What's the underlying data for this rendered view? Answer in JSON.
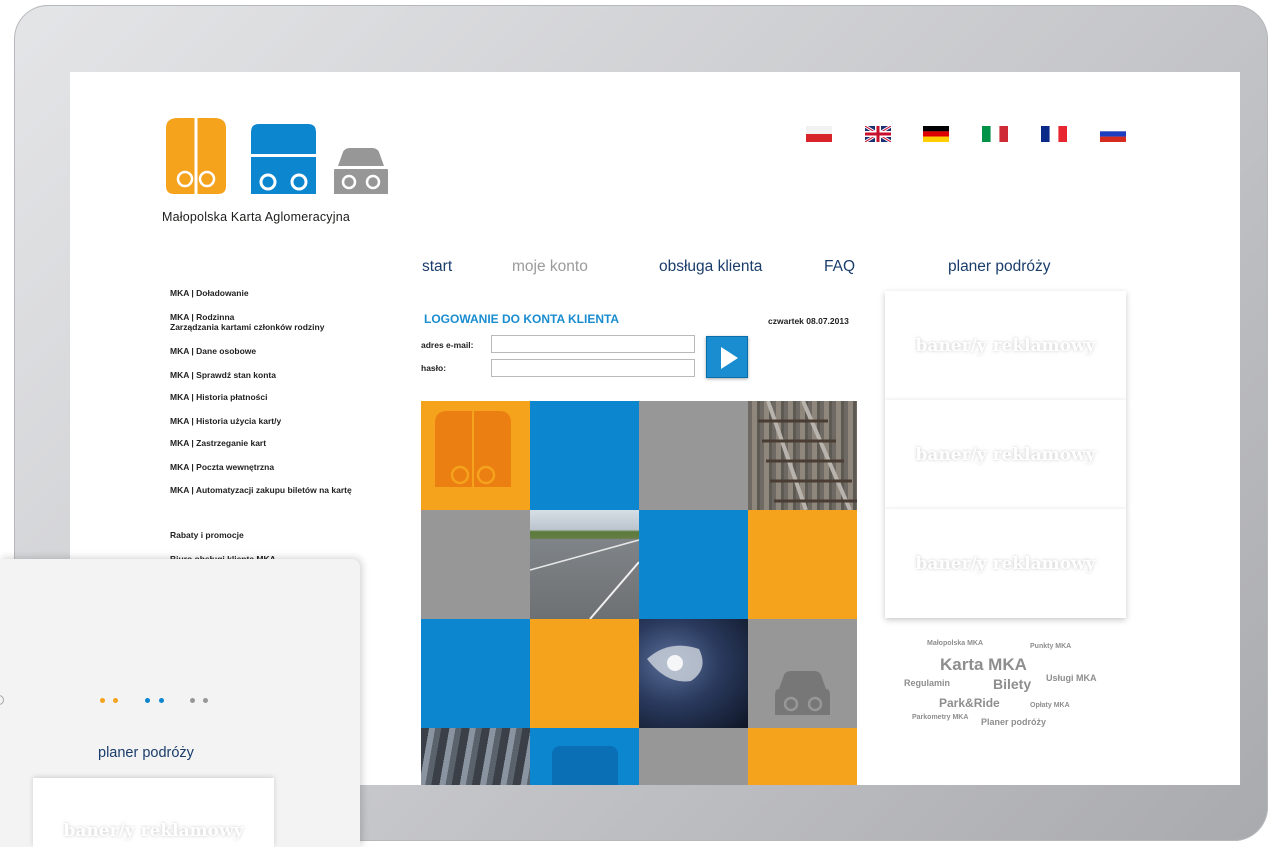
{
  "logo": {
    "name": "Małopolska Karta Aglomeracyjna"
  },
  "flags": [
    "flag-pl",
    "flag-gb",
    "flag-de",
    "flag-it",
    "flag-fr",
    "flag-ru"
  ],
  "nav": {
    "start": "start",
    "account": "moje konto",
    "service": "obsługa klienta",
    "faq": "FAQ",
    "planner": "planer podróży"
  },
  "sidebar": {
    "items": [
      "MKA | Doładowanie",
      "MKA | Rodzinna",
      "Zarządzania kartami członków rodziny",
      "MKA | Dane osobowe",
      "MKA | Sprawdź stan konta",
      "MKA | Historia płatności",
      "MKA | Historia użycia kart/y",
      "MKA | Zastrzeganie kart",
      "MKA | Poczta wewnętrzna",
      "MKA | Automatyzacji zakupu biletów na kartę"
    ],
    "extra": [
      "Rabaty i promocje",
      "Biuro obsługi klienta MKA"
    ]
  },
  "login": {
    "title": "LOGOWANIE DO KONTA KLIENTA",
    "date": "czwartek 08.07.2013",
    "email_label": "adres e-mail:",
    "password_label": "hasło:",
    "email_value": "",
    "password_value": ""
  },
  "banners": [
    "baner/y reklamowy",
    "baner/y reklamowy",
    "baner/y reklamowy"
  ],
  "tags": [
    "Małopolska MKA",
    "Punkty MKA",
    "Karta MKA",
    "Regulamin",
    "Bilety",
    "Usługi MKA",
    "Park&Ride",
    "Opłaty MKA",
    "Parkometry MKA",
    "Planer podróży"
  ],
  "overlay": {
    "planner": "planer podróży",
    "banner": "baner/y reklamowy"
  },
  "colors": {
    "orange": "#f5a21c",
    "blue": "#0d86d0",
    "gray": "#979797",
    "navy": "#1a3d6b",
    "accent": "#1a8dd0"
  }
}
